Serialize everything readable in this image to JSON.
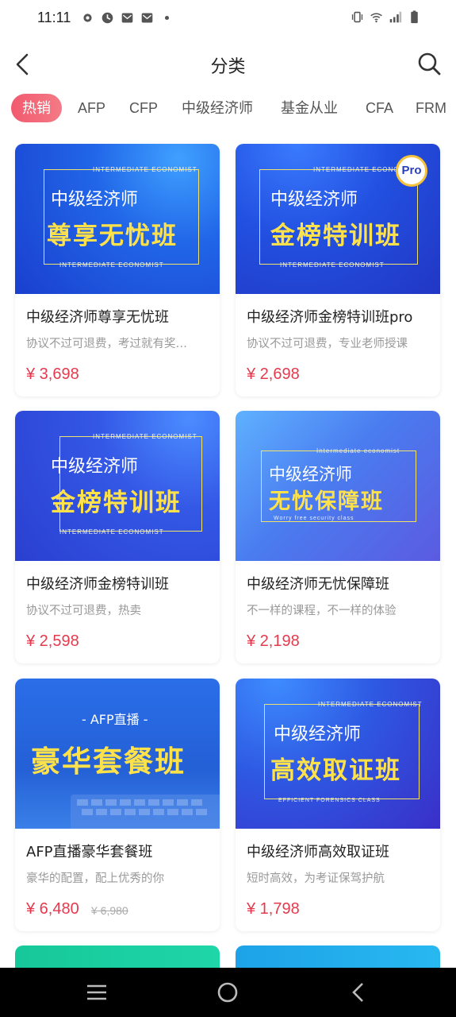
{
  "status_bar": {
    "time": "11:11",
    "left_icons": [
      "gear-icon",
      "clock-app-icon",
      "mail-icon",
      "mail-icon",
      "dot-icon"
    ],
    "right_icons": [
      "vibrate-icon",
      "wifi-icon",
      "signal-icon",
      "battery-icon"
    ]
  },
  "header": {
    "title": "分类",
    "back_icon": "back-arrow-icon",
    "search_icon": "search-icon"
  },
  "tabs": [
    {
      "label": "热销",
      "active": true
    },
    {
      "label": "AFP",
      "active": false
    },
    {
      "label": "CFP",
      "active": false
    },
    {
      "label": "中级经济师",
      "active": false
    },
    {
      "label": "基金从业",
      "active": false
    },
    {
      "label": "CFA",
      "active": false
    },
    {
      "label": "FRM",
      "active": false
    }
  ],
  "courses": [
    {
      "banner_top": "INTERMEDIATE ECONOMIST",
      "banner_sub": "中级经济师",
      "banner_main": "尊享无忧班",
      "banner_bottom": "INTERMEDIATE ECONOMIST",
      "title": "中级经济师尊享无忧班",
      "desc": "协议不过可退费，考过就有奖…",
      "price": "¥ 3,698"
    },
    {
      "banner_top": "INTERMEDIATE ECONOMIST",
      "banner_sub": "中级经济师",
      "banner_main": "金榜特训班",
      "banner_bottom": "INTERMEDIATE ECONOMIST",
      "badge": "Pro",
      "title": "中级经济师金榜特训班pro",
      "desc": "协议不过可退费，专业老师授课",
      "price": "¥ 2,698"
    },
    {
      "banner_top": "INTERMEDIATE ECONOMIST",
      "banner_sub": "中级经济师",
      "banner_main": "金榜特训班",
      "banner_bottom": "INTERMEDIATE ECONOMIST",
      "title": "中级经济师金榜特训班",
      "desc": "协议不过可退费，热卖",
      "price": "¥ 2,598"
    },
    {
      "banner_top": "Intermediate economist",
      "banner_sub": "中级经济师",
      "banner_main": "无忧保障班",
      "banner_bottom": "Worry free security class",
      "title": "中级经济师无忧保障班",
      "desc": "不一样的课程，不一样的体验",
      "price": "¥ 2,198"
    },
    {
      "banner_sub": "- AFP直播 -",
      "banner_main": "豪华套餐班",
      "title": "AFP直播豪华套餐班",
      "desc": "豪华的配置，配上优秀的你",
      "price": "¥ 6,480",
      "old_price": "¥ 6,980"
    },
    {
      "banner_top": "INTERMEDIATE ECONOMIST",
      "banner_sub": "中级经济师",
      "banner_main": "高效取证班",
      "banner_bottom": "EFFICIENT FORENSICS CLASS",
      "title": "中级经济师高效取证班",
      "desc": "短时高效，为考证保驾护航",
      "price": "¥ 1,798"
    }
  ],
  "system_nav": [
    "menu-icon",
    "home-icon",
    "back-icon"
  ],
  "colors": {
    "accent": "#e53a4e",
    "tab_active": "#f25a6e",
    "banner_gold": "#ffe14a"
  }
}
